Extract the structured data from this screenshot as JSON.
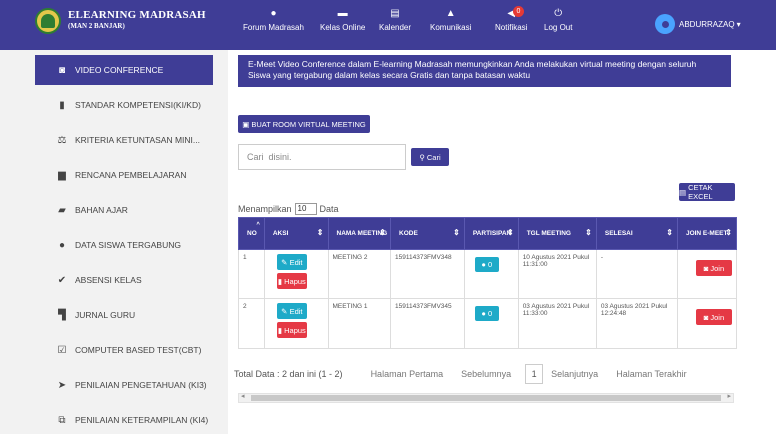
{
  "brand": {
    "title": "ELEARNING MADRASAH",
    "subtitle": "(MAN 2 BANJAR)"
  },
  "nav": [
    {
      "label": "Forum Madrasah",
      "icon": "chat-icon"
    },
    {
      "label": "Kelas Online",
      "icon": "graduation-cap-icon"
    },
    {
      "label": "Kalender",
      "icon": "calendar-icon"
    },
    {
      "label": "Komunikasi",
      "icon": "bell-icon"
    },
    {
      "label": "Notifikasi",
      "icon": "megaphone-icon",
      "badge": "0"
    },
    {
      "label": "Log Out",
      "icon": "power-icon"
    }
  ],
  "user": {
    "name": "ABDURRAZAQ"
  },
  "sidebar": {
    "items": [
      {
        "label": "VIDEO CONFERENCE",
        "icon": "camera-icon",
        "active": true
      },
      {
        "label": "STANDAR KOMPETENSI(KI/KD)",
        "icon": "book-icon"
      },
      {
        "label": "KRITERIA KETUNTASAN MINI...",
        "icon": "balance-scale-icon"
      },
      {
        "label": "RENCANA PEMBELAJARAN",
        "icon": "briefcase-icon"
      },
      {
        "label": "BAHAN AJAR",
        "icon": "folder-open-icon"
      },
      {
        "label": "DATA SISWA TERGABUNG",
        "icon": "users-icon"
      },
      {
        "label": "ABSENSI KELAS",
        "icon": "check-icon"
      },
      {
        "label": "JURNAL GURU",
        "icon": "binoculars-icon"
      },
      {
        "label": "COMPUTER BASED TEST(CBT)",
        "icon": "edit-icon"
      },
      {
        "label": "PENILAIAN PENGETAHUAN (KI3)",
        "icon": "plane-icon"
      },
      {
        "label": "PENILAIAN KETERAMPILAN (KI4)",
        "icon": "sitemap-icon"
      }
    ]
  },
  "main": {
    "banner": "E-Meet Video Conference dalam E-learning Madrasah memungkinkan Anda melakukan virtual meeting dengan seluruh Siswa yang tergabung dalam kelas secara Gratis dan tanpa batasan waktu",
    "room_button": "BUAT ROOM VIRTUAL MEETING",
    "search_placeholder": "Cari  disini.",
    "search_button": "Cari",
    "excel_button": "CETAK EXCEL",
    "show_prefix": "Menampilkan",
    "show_value": "10",
    "show_suffix": "Data",
    "table": {
      "headers": [
        "NO",
        "AKSI",
        "NAMA MEETING",
        "KODE",
        "PARTISIPAN",
        "TGL MEETING",
        "SELESAI",
        "JOIN E-MEET"
      ],
      "edit_label": "Edit",
      "hapus_label": "Hapus",
      "join_label": "Join",
      "rows": [
        {
          "no": "1",
          "nama": "MEETING 2",
          "kode": "159114373FMV348",
          "partisipan": "0",
          "tgl": "10 Agustus 2021 Pukul 11:31:00",
          "selesai": "-"
        },
        {
          "no": "2",
          "nama": "MEETING 1",
          "kode": "159114373FMV345",
          "partisipan": "0",
          "tgl": "03 Agustus 2021 Pukul 11:33:00",
          "selesai": "03 Agustus 2021 Pukul 12:24:48"
        }
      ]
    },
    "pager": {
      "total": "Total Data : 2 dan ini (1 - 2)",
      "first": "Halaman Pertama",
      "prev": "Sebelumnya",
      "current": "1",
      "next": "Selanjutnya",
      "last": "Halaman Terakhir"
    }
  },
  "colors": {
    "primary": "#3f3d96",
    "info": "#1eaac8",
    "danger": "#e53945"
  }
}
